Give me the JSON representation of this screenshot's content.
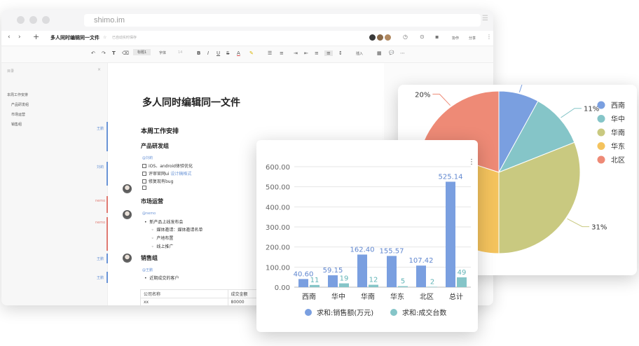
{
  "browser": {
    "url": "shimo.im",
    "menu_icon": "hamburger-icon"
  },
  "docbar": {
    "back": "‹",
    "forward": "›",
    "new": "+",
    "doc_name": "多人同时编辑同一文件",
    "save_status": "已自动实时保存",
    "collab_label": "协作",
    "share_label": "分享",
    "avatar_colors": [
      "#3a3a3a",
      "#8a6a4a",
      "#b08860",
      "#4a4a4a"
    ]
  },
  "toolbar": {
    "undo": "↶",
    "redo": "↷",
    "format_paint": "T",
    "clear": "⌫",
    "style_select": "标题1",
    "font_select": "字体",
    "size_select": "14",
    "bold": "B",
    "italic": "I",
    "underline": "U",
    "strike": "S",
    "font_color": "A",
    "highlight": "✎",
    "ul": "☰",
    "ol": "≡",
    "indent": "⇥",
    "outdent": "⇤",
    "align_left": "≡",
    "align_center": "≡",
    "line_height": "↕",
    "insert": "插入",
    "table": "▦",
    "comment": "💬",
    "more": "⋯"
  },
  "sidebar": {
    "label": "目录",
    "close": "×",
    "items": [
      "本周工作安排",
      "产品研发组",
      "市场运营",
      "销售组"
    ]
  },
  "comments": {
    "tags": [
      "王鹏",
      "刘莉",
      "nemo",
      "nemo",
      "王鹏",
      "王鹏"
    ],
    "colors": [
      "#6a94d6",
      "#6a94d6",
      "#e07a72",
      "#e07a72",
      "#6a94d6",
      "#6a94d6"
    ]
  },
  "document": {
    "title": "多人同时编辑同一文件",
    "section": "本周工作安排",
    "group1": {
      "heading": "产品研发组",
      "mention": "@刘莉",
      "tasks": [
        {
          "text": "iOS、android体验优化",
          "link": ""
        },
        {
          "text": "评审官网ui",
          "link": "设计稿格式"
        },
        {
          "text": "修复现有bug",
          "link": ""
        },
        {
          "text": "",
          "link": ""
        }
      ]
    },
    "group2": {
      "heading": "市场运营",
      "mention": "@nemo",
      "bullet": "新产品上线发布会",
      "sub": [
        "媒体邀请：媒体邀请名单",
        "产地布置",
        "线上推广"
      ]
    },
    "group3": {
      "heading": "销售组",
      "mention": "@王鹏",
      "bullet": "近期成交的客户"
    },
    "table": {
      "headers": [
        "公司名称",
        "成交金额"
      ],
      "rows": [
        [
          "xx",
          "80000"
        ]
      ]
    }
  },
  "pie_chart": {
    "chart_data": {
      "type": "pie",
      "labels": [
        "西南",
        "华中",
        "华南",
        "华东",
        "北区"
      ],
      "values": [
        8,
        11,
        31,
        30,
        20
      ],
      "value_labels": [
        "8%",
        "11%",
        "31%",
        "",
        "20%"
      ],
      "colors": [
        "#7a9fe0",
        "#85c5c8",
        "#c9c980",
        "#f4c35d",
        "#ee8a76"
      ],
      "legend_position": "right"
    }
  },
  "bar_chart": {
    "more_icon": "⋮",
    "chart_data": {
      "type": "bar",
      "categories": [
        "西南",
        "华中",
        "华南",
        "华东",
        "北区",
        "总计"
      ],
      "series": [
        {
          "name": "求和:销售额(万元)",
          "values": [
            40.6,
            59.15,
            162.4,
            155.57,
            107.42,
            525.14
          ],
          "labels": [
            "40.60",
            "59.15",
            "162.40",
            "155.57",
            "107.42",
            "525.14"
          ],
          "color": "#7a9fe0"
        },
        {
          "name": "求和:成交台数",
          "values": [
            11,
            19,
            12,
            5,
            2,
            49
          ],
          "labels": [
            "11",
            "19",
            "12",
            "5",
            "2",
            "49"
          ],
          "color": "#85c5c8"
        }
      ],
      "ylim": [
        0,
        600
      ],
      "yticks": [
        "0.00",
        "100.00",
        "200.00",
        "300.00",
        "400.00",
        "500.00",
        "600.00"
      ],
      "grid": true,
      "legend_position": "bottom"
    }
  }
}
